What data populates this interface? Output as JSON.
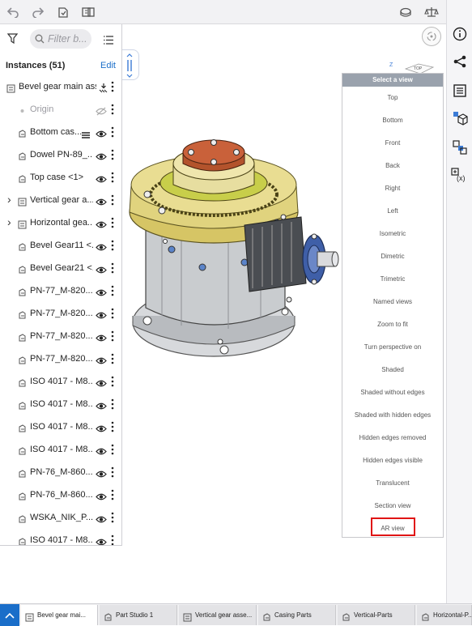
{
  "filter": {
    "placeholder": "Filter b..."
  },
  "instances": {
    "title": "Instances (51)",
    "edit_label": "Edit"
  },
  "tree": [
    {
      "label": "Bevel gear main ass...",
      "type": "assembly",
      "caret": false,
      "extra": "download-hatch",
      "visible": true,
      "wide": true
    },
    {
      "label": "Origin",
      "type": "origin",
      "caret": false,
      "extra": "",
      "visible": false,
      "muted": true
    },
    {
      "label": "Bottom cas...",
      "type": "part",
      "caret": false,
      "extra": "hatch",
      "visible": true
    },
    {
      "label": "Dowel PN-89_...",
      "type": "part",
      "caret": false,
      "extra": "",
      "visible": true
    },
    {
      "label": "Top case <1>",
      "type": "part",
      "caret": false,
      "extra": "",
      "visible": true
    },
    {
      "label": "Vertical gear a...",
      "type": "assembly",
      "caret": true,
      "extra": "",
      "visible": true
    },
    {
      "label": "Horizontal gea...",
      "type": "assembly",
      "caret": true,
      "extra": "",
      "visible": true
    },
    {
      "label": "Bevel Gear11 <...",
      "type": "part",
      "caret": false,
      "extra": "",
      "visible": true
    },
    {
      "label": "Bevel Gear21 <...",
      "type": "part",
      "caret": false,
      "extra": "",
      "visible": true
    },
    {
      "label": "PN-77_M-820...",
      "type": "part",
      "caret": false,
      "extra": "",
      "visible": true
    },
    {
      "label": "PN-77_M-820...",
      "type": "part",
      "caret": false,
      "extra": "",
      "visible": true
    },
    {
      "label": "PN-77_M-820...",
      "type": "part",
      "caret": false,
      "extra": "",
      "visible": true
    },
    {
      "label": "PN-77_M-820...",
      "type": "part",
      "caret": false,
      "extra": "",
      "visible": true
    },
    {
      "label": "ISO 4017 - M8...",
      "type": "part",
      "caret": false,
      "extra": "",
      "visible": true
    },
    {
      "label": "ISO 4017 - M8...",
      "type": "part",
      "caret": false,
      "extra": "",
      "visible": true
    },
    {
      "label": "ISO 4017 - M8...",
      "type": "part",
      "caret": false,
      "extra": "",
      "visible": true
    },
    {
      "label": "ISO 4017 - M8...",
      "type": "part",
      "caret": false,
      "extra": "",
      "visible": true
    },
    {
      "label": "PN-76_M-860...",
      "type": "part",
      "caret": false,
      "extra": "",
      "visible": true
    },
    {
      "label": "PN-76_M-860...",
      "type": "part",
      "caret": false,
      "extra": "",
      "visible": true
    },
    {
      "label": "WSKA_NIK_P...",
      "type": "part",
      "caret": false,
      "extra": "",
      "visible": true
    },
    {
      "label": "ISO 4017 - M8...",
      "type": "part",
      "caret": false,
      "extra": "",
      "visible": true
    }
  ],
  "view_cube": {
    "axis_label": "Z",
    "face_label": "TOP"
  },
  "view_menu": {
    "header": "Select a view",
    "items": [
      "Top",
      "Bottom",
      "Front",
      "Back",
      "Right",
      "Left",
      "Isometric",
      "Dimetric",
      "Trimetric",
      "Named views",
      "Zoom to fit",
      "Turn perspective on",
      "Shaded",
      "Shaded without edges",
      "Shaded with hidden edges",
      "Hidden edges removed",
      "Hidden edges visible",
      "Translucent",
      "Section view",
      "AR view"
    ],
    "highlighted": "AR view"
  },
  "tabs": [
    {
      "label": "Bevel gear mai...",
      "icon": "assembly-icon",
      "active": true
    },
    {
      "label": "Part Studio 1",
      "icon": "part-studio-icon",
      "active": false
    },
    {
      "label": "Vertical gear asse...",
      "icon": "assembly-icon",
      "active": false
    },
    {
      "label": "Casing Parts",
      "icon": "part-studio-icon",
      "active": false
    },
    {
      "label": "Vertical-Parts",
      "icon": "part-studio-icon",
      "active": false
    },
    {
      "label": "Horizontal-P...",
      "icon": "part-studio-icon",
      "active": false
    }
  ],
  "colors": {
    "accent": "#1a6ec9",
    "highlight": "#e01515",
    "menu_header": "#9aa2ad"
  }
}
